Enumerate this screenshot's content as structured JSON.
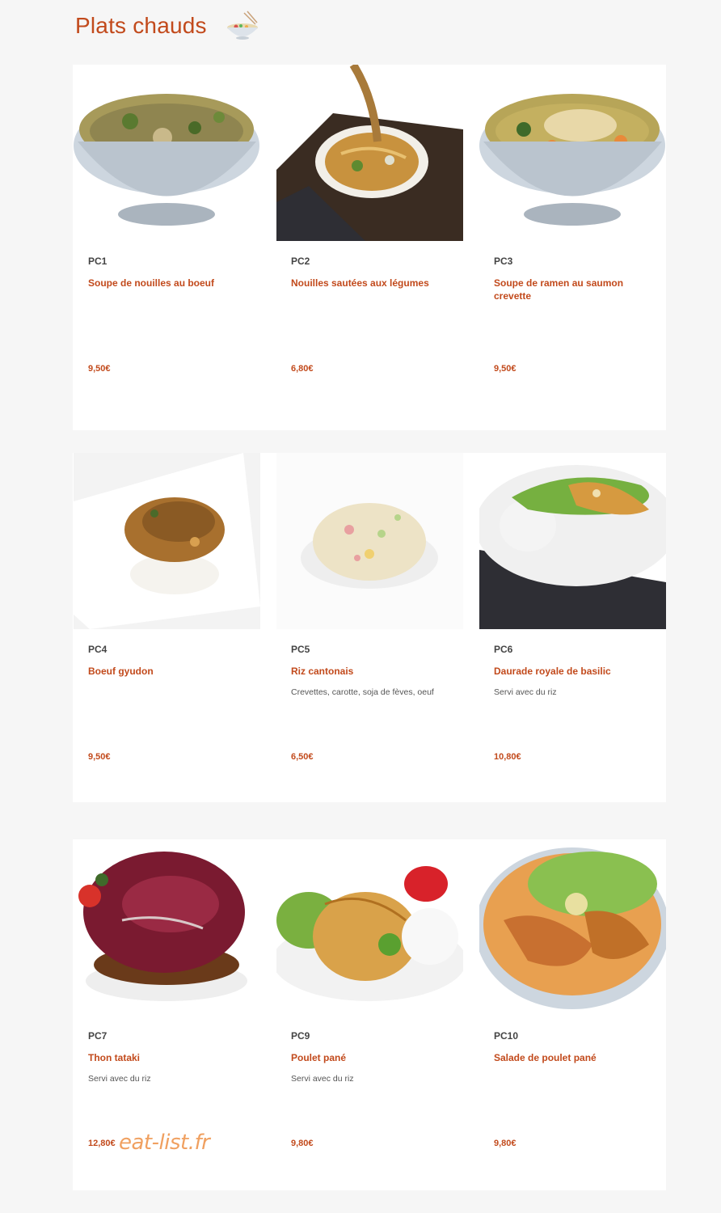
{
  "section": {
    "title": "Plats chauds",
    "icon": "noodle-bowl-icon"
  },
  "colors": {
    "accent": "#c24a1c",
    "background": "#f6f6f6",
    "card": "#ffffff",
    "watermark": "#f0a060"
  },
  "items": [
    {
      "code": "PC1",
      "name": "Soupe de nouilles au boeuf",
      "description": "",
      "price": "9,50€"
    },
    {
      "code": "PC2",
      "name": "Nouilles sautées aux légumes",
      "description": "",
      "price": "6,80€"
    },
    {
      "code": "PC3",
      "name": "Soupe de ramen au saumon crevette",
      "description": "",
      "price": "9,50€"
    },
    {
      "code": "PC4",
      "name": "Boeuf gyudon",
      "description": "",
      "price": "9,50€"
    },
    {
      "code": "PC5",
      "name": "Riz cantonais",
      "description": "Crevettes, carotte, soja de fèves, oeuf",
      "price": "6,50€"
    },
    {
      "code": "PC6",
      "name": "Daurade royale de basilic",
      "description": "Servi avec du riz",
      "price": "10,80€"
    },
    {
      "code": "PC7",
      "name": "Thon tataki",
      "description": "Servi avec du riz",
      "price": "12,80€"
    },
    {
      "code": "PC9",
      "name": "Poulet pané",
      "description": "Servi avec du riz",
      "price": "9,80€"
    },
    {
      "code": "PC10",
      "name": "Salade de poulet pané",
      "description": "",
      "price": "9,80€"
    }
  ],
  "watermark": "eat-list.fr"
}
